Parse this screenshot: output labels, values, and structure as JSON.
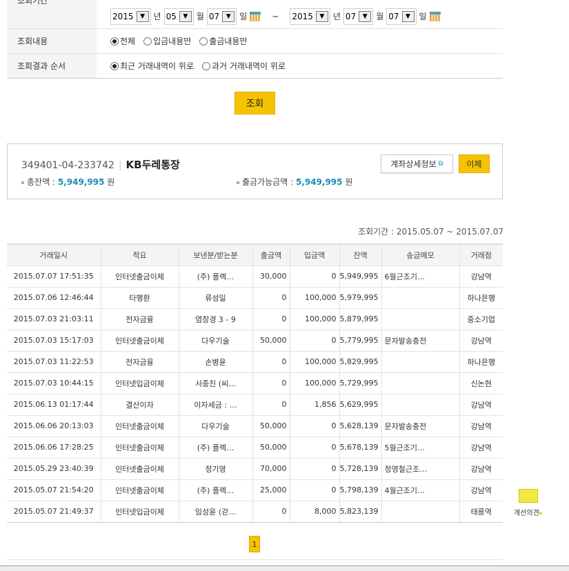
{
  "filter": {
    "period_label": "조회기간",
    "from": {
      "year": "2015",
      "month": "05",
      "day": "07"
    },
    "to": {
      "year": "2015",
      "month": "07",
      "day": "07"
    },
    "year_unit": "년",
    "month_unit": "월",
    "day_unit": "일",
    "tilde": "~",
    "content_label": "조회내용",
    "content_options": [
      "전체",
      "입금내용만",
      "출금내용만"
    ],
    "content_selected": 0,
    "order_label": "조회결과 순서",
    "order_options": [
      "최근 거래내역이 위로",
      "과거 거래내역이 위로"
    ],
    "order_selected": 0,
    "search_label": "조회"
  },
  "account": {
    "number": "349401-04-233742",
    "name": "KB두레통장",
    "total_label": "총잔액 :",
    "total": "5,949,995",
    "unit": "원",
    "available_label": "출금가능금액 :",
    "available": "5,949,995",
    "detail_label": "계좌상세정보",
    "transfer_label": "이체"
  },
  "period_text": "조회기간 : 2015.05.07 ~ 2015.07.07",
  "table": {
    "headers": [
      "거래일시",
      "적요",
      "보낸분/받는분",
      "출금액",
      "입금액",
      "잔액",
      "송금메모",
      "거래점"
    ],
    "rows": [
      [
        "2015.07.07 17:51:35",
        "인터넷출금이체",
        "(주) 플렉…",
        "30,000",
        "0",
        "5,949,995",
        "6월근조기…",
        "강남역"
      ],
      [
        "2015.07.06 12:46:44",
        "타행환",
        "류성일",
        "0",
        "100,000",
        "5,979,995",
        "",
        "하나은행"
      ],
      [
        "2015.07.03 21:03:11",
        "전자금융",
        "염창경 3 - 9",
        "0",
        "100,000",
        "5,879,995",
        "",
        "중소기업"
      ],
      [
        "2015.07.03 15:17:03",
        "인터넷출금이체",
        "다우기술",
        "50,000",
        "0",
        "5,779,995",
        "문자발송충전",
        "강남역"
      ],
      [
        "2015.07.03 11:22:53",
        "전자금융",
        "손병윤",
        "0",
        "100,000",
        "5,829,995",
        "",
        "하나은행"
      ],
      [
        "2015.07.03 10:44:15",
        "인터넷입금이체",
        "서종진 (씨…",
        "0",
        "100,000",
        "5,729,995",
        "",
        "신논현"
      ],
      [
        "2015.06.13 01:17:44",
        "결산이자",
        "이자세금 : …",
        "0",
        "1,856",
        "5,629,995",
        "",
        "강남역"
      ],
      [
        "2015.06.06 20:13:03",
        "인터넷출금이체",
        "다우기술",
        "50,000",
        "0",
        "5,628,139",
        "문자발송충전",
        "강남역"
      ],
      [
        "2015.06.06 17:28:25",
        "인터넷출금이체",
        "(주) 플렉…",
        "50,000",
        "0",
        "5,678,139",
        "5월근조기…",
        "강남역"
      ],
      [
        "2015.05.29 23:40:39",
        "인터넷출금이체",
        "정기영",
        "70,000",
        "0",
        "5,728,139",
        "정영철근조…",
        "강남역"
      ],
      [
        "2015.05.07 21:54:20",
        "인터넷출금이체",
        "(주) 플렉…",
        "25,000",
        "0",
        "5,798,139",
        "4월근조기…",
        "강남역"
      ],
      [
        "2015.05.07 21:49:37",
        "인터넷입금이체",
        "임성윤 (걷…",
        "0",
        "8,000",
        "5,823,139",
        "",
        "태릉역"
      ]
    ]
  },
  "pagination": {
    "current": "1"
  },
  "feedback_label": "개선의견",
  "colors": {
    "accent": "#f6c300",
    "amount": "#1a8bb8"
  }
}
